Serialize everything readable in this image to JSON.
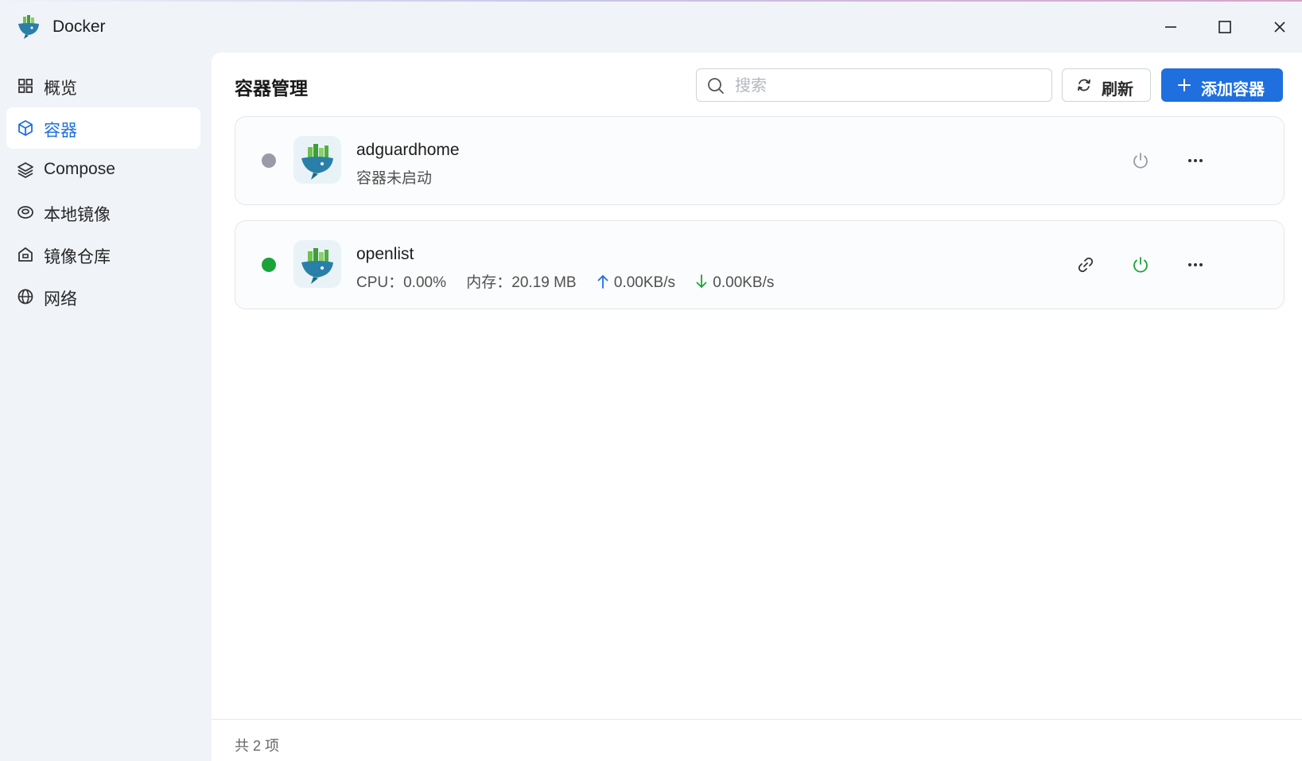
{
  "window": {
    "title": "Docker"
  },
  "sidebar": {
    "items": [
      {
        "label": "概览",
        "icon": "grid-icon",
        "active": false
      },
      {
        "label": "容器",
        "icon": "cube-icon",
        "active": true
      },
      {
        "label": "Compose",
        "icon": "layers-icon",
        "active": false
      },
      {
        "label": "本地镜像",
        "icon": "disc-icon",
        "active": false
      },
      {
        "label": "镜像仓库",
        "icon": "house-icon",
        "active": false
      },
      {
        "label": "网络",
        "icon": "globe-icon",
        "active": false
      }
    ]
  },
  "main": {
    "title": "容器管理",
    "search": {
      "placeholder": "搜索",
      "value": ""
    },
    "refresh_label": "刷新",
    "add_label": "添加容器"
  },
  "containers": [
    {
      "name": "adguardhome",
      "status_text": "容器未启动",
      "running": false,
      "status_color": "#9a9aa8"
    },
    {
      "name": "openlist",
      "running": true,
      "status_color": "#1aa33a",
      "cpu": "CPU：0.00%",
      "memory": "内存：20.19 MB",
      "upload": "0.00KB/s",
      "download": "0.00KB/s"
    }
  ],
  "footer": {
    "count_text": "共 2 项"
  },
  "colors": {
    "accent": "#1f6fde",
    "running": "#1aa33a",
    "stopped": "#9a9aa8"
  }
}
